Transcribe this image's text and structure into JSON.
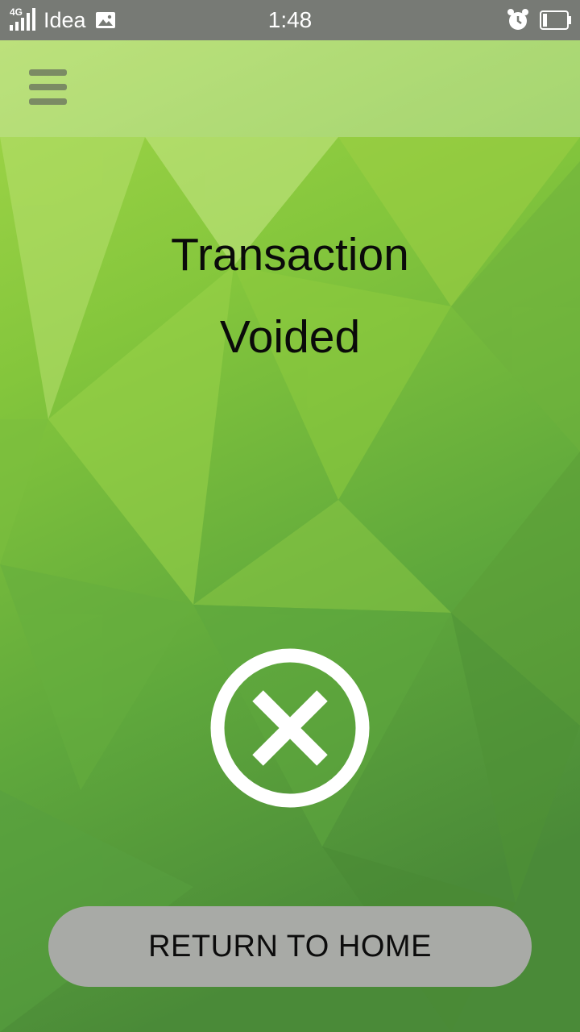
{
  "status_bar": {
    "network": "4G",
    "carrier": "Idea",
    "time": "1:48"
  },
  "icons": {
    "menu": "hamburger-menu-icon",
    "status": "void-x-circle-icon",
    "alarm": "alarm-clock-icon",
    "battery": "battery-icon",
    "signal": "signal-bars-icon",
    "image": "image-notification-icon"
  },
  "message": {
    "line1": "Transaction",
    "line2": "Voided"
  },
  "actions": {
    "return_home": "RETURN TO HOME"
  },
  "colors": {
    "status_bar": "#777a75",
    "background_light": "#9ccc3c",
    "background_dark": "#4a8a3a",
    "button": "#a8aaa6",
    "icon": "#ffffff"
  }
}
